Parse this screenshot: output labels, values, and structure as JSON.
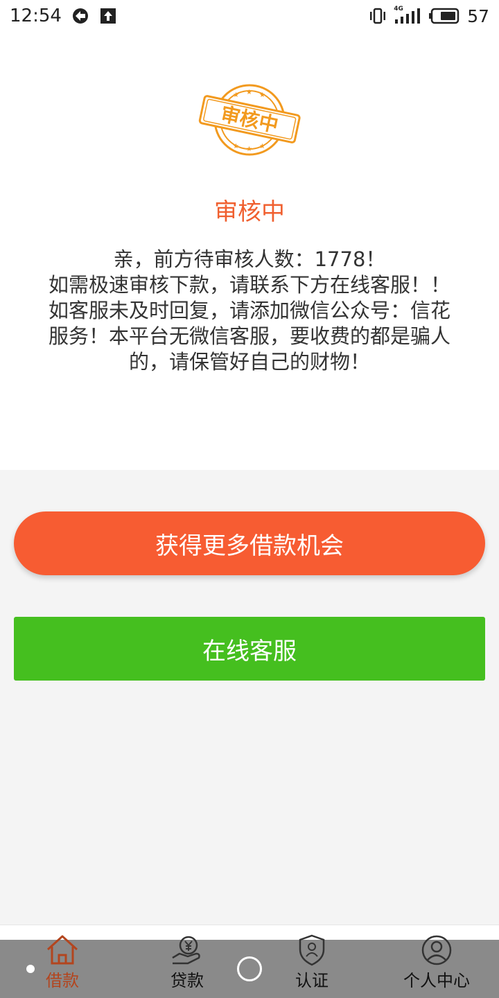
{
  "status_bar": {
    "time": "12:54",
    "network": "4G",
    "battery": "57"
  },
  "stamp": {
    "text": "审核中",
    "color": "#f29a1f"
  },
  "status_title": "审核中",
  "message_lines": [
    "亲，前方待审核人数：1778！",
    "如需极速审核下款，请联系下方在线客服！！",
    "如客服未及时回复，请添加微信公众号：信花",
    "服务！本平台无微信客服，要收费的都是骗人",
    "的，请保管好自己的财物！"
  ],
  "buttons": {
    "more_loan": "获得更多借款机会",
    "online_service": "在线客服"
  },
  "nav": {
    "items": [
      {
        "label": "借款",
        "icon": "home-icon",
        "active": true
      },
      {
        "label": "贷款",
        "icon": "yen-hand-icon",
        "active": false
      },
      {
        "label": "认证",
        "icon": "shield-check-icon",
        "active": false
      },
      {
        "label": "个人中心",
        "icon": "user-icon",
        "active": false
      }
    ]
  },
  "colors": {
    "accent_orange": "#f75c32",
    "title_orange": "#f06030",
    "service_green": "#45bf1f",
    "nav_active": "#b3451e"
  }
}
